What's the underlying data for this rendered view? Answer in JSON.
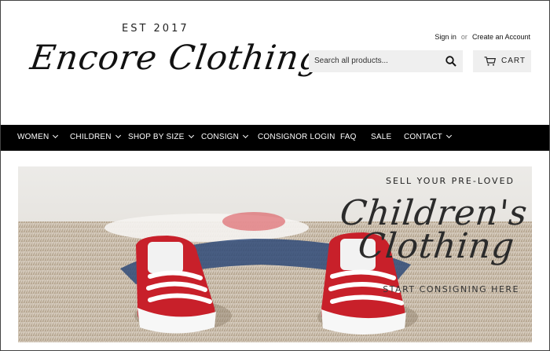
{
  "brand": {
    "established": "EST 2017",
    "name": "Encore Clothing"
  },
  "account": {
    "sign_in": "Sign in",
    "or": "or",
    "create": "Create an Account"
  },
  "search": {
    "placeholder": "Search all products...",
    "icon": "search-icon"
  },
  "cart": {
    "label": "CART",
    "icon": "cart-icon"
  },
  "nav": {
    "items": [
      {
        "label": "WOMEN",
        "dropdown": true
      },
      {
        "label": "CHILDREN",
        "dropdown": true
      },
      {
        "label": "SHOP BY SIZE",
        "dropdown": true
      },
      {
        "label": "CONSIGN",
        "dropdown": true
      },
      {
        "label": "CONSIGNOR LOGIN",
        "dropdown": false
      },
      {
        "label": "FAQ",
        "dropdown": false
      },
      {
        "label": "SALE",
        "dropdown": false
      },
      {
        "label": "CONTACT",
        "dropdown": true
      }
    ]
  },
  "hero": {
    "eyebrow": "SELL YOUR PRE-LOVED",
    "script_line1": "Children's",
    "script_line2": "Clothing",
    "cta": "START CONSIGNING HERE"
  },
  "colors": {
    "nav_bg": "#000000",
    "field_bg": "#efefef",
    "sneaker_red": "#c8202a"
  }
}
